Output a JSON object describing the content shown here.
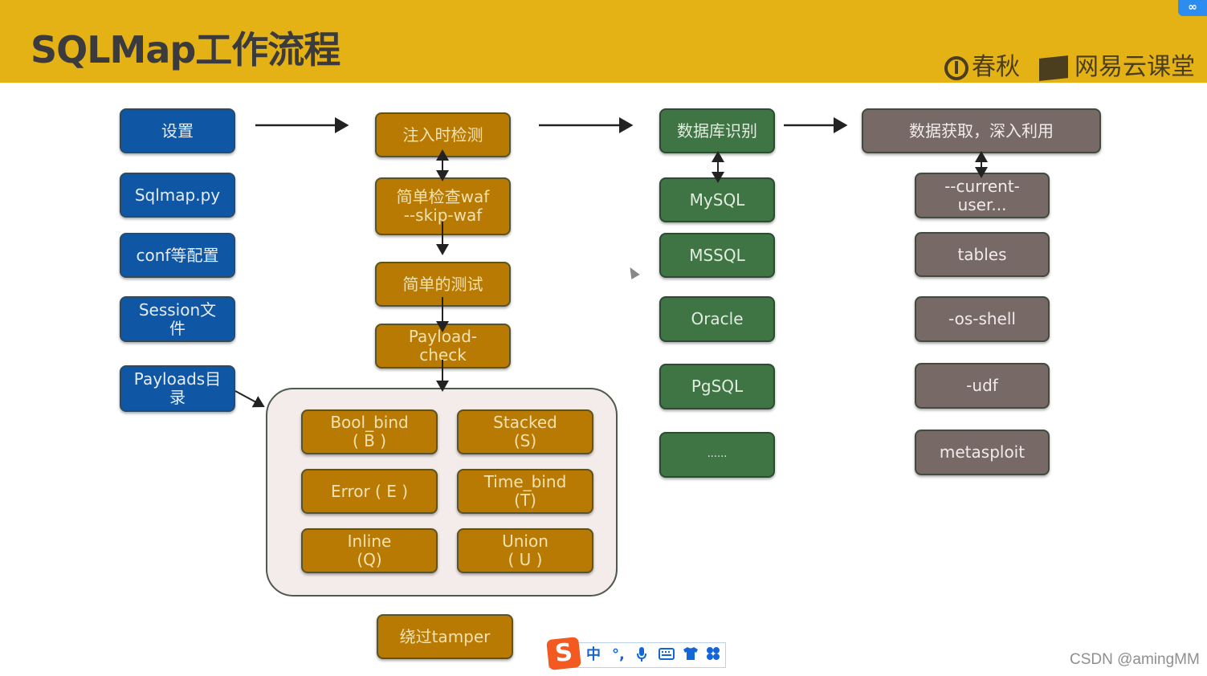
{
  "header": {
    "title": "SQLMap工作流程",
    "brand1": "春秋",
    "brand2": "网易云课堂",
    "cloud_badge": "∞"
  },
  "colors": {
    "header_bg": "#e5b216",
    "blue_box": "#0f57a5",
    "gold_box": "#b87a02",
    "green_box": "#3f7444",
    "gray_box": "#776a66",
    "container_bg": "#f4ebeb"
  },
  "column_setup": {
    "items": [
      "设置",
      "Sqlmap.py",
      "conf等配置",
      "Session文\n件",
      "Payloads目\n录"
    ]
  },
  "column_detect": {
    "items": [
      "注入时检测",
      "简单检查waf\n--skip-waf",
      "简单的测试",
      "Payload-\ncheck"
    ]
  },
  "techniques": {
    "items": [
      "Bool_bind\n( B )",
      "Stacked\n(S)",
      "Error ( E )",
      "Time_bind\n(T)",
      "Inline\n(Q)",
      "Union\n( U )"
    ]
  },
  "tamper": {
    "label": "绕过tamper"
  },
  "column_db": {
    "items": [
      "数据库识别",
      "MySQL",
      "MSSQL",
      "Oracle",
      "PgSQL",
      "......"
    ]
  },
  "column_exploit": {
    "items": [
      "数据获取，深入利用",
      "--current-\nuser...",
      "tables",
      "-os-shell",
      "-udf",
      "metasploit"
    ]
  },
  "ime_toolbar": {
    "logo": "S",
    "mode": "中",
    "punct": "°,",
    "icons": [
      "microphone-icon",
      "keyboard-icon",
      "skin-icon",
      "toolbox-icon"
    ]
  },
  "watermark": "CSDN @amingMM"
}
